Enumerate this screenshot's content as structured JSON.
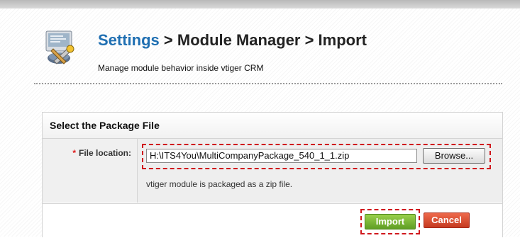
{
  "header": {
    "link": "Settings",
    "sep1": " > ",
    "crumb2": "Module Manager",
    "sep2": " > ",
    "crumb3": "Import",
    "subtitle": "Manage module behavior inside vtiger CRM",
    "icon": "settings-tools-icon"
  },
  "form": {
    "title": "Select the Package File",
    "required_mark": "*",
    "file_label": "File location:",
    "file_value": "H:\\ITS4You\\MultiCompanyPackage_540_1_1.zip",
    "browse_label": "Browse...",
    "help": "vtiger module is packaged as a zip file."
  },
  "actions": {
    "import_label": "Import",
    "cancel_label": "Cancel"
  },
  "colors": {
    "link": "#1f6fb2",
    "highlight_border": "#d0181d",
    "import_green": "#6fae2c",
    "cancel_red": "#d9472b"
  }
}
